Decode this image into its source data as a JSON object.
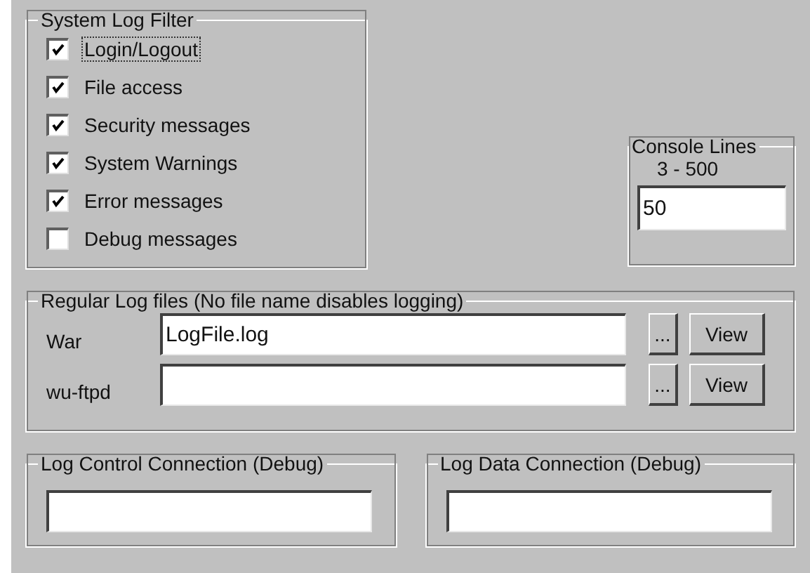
{
  "filter": {
    "title": "System Log Filter",
    "options": [
      {
        "label": "Login/Logout",
        "checked": true,
        "focused": true
      },
      {
        "label": "File access",
        "checked": true,
        "focused": false
      },
      {
        "label": "Security messages",
        "checked": true,
        "focused": false
      },
      {
        "label": "System Warnings",
        "checked": true,
        "focused": false
      },
      {
        "label": "Error messages",
        "checked": true,
        "focused": false
      },
      {
        "label": "Debug messages",
        "checked": false,
        "focused": false
      }
    ]
  },
  "console": {
    "title": "Console Lines",
    "range": "3 - 500",
    "value": "50"
  },
  "log_files": {
    "title": "Regular Log files (No file name disables logging)",
    "rows": [
      {
        "label": "War",
        "value": "LogFile.log",
        "browse": "...",
        "view": "View"
      },
      {
        "label": "wu-ftpd",
        "browse": "...",
        "view": "View"
      }
    ]
  },
  "connections": [
    {
      "title": "Log Control Connection (Debug)"
    },
    {
      "title": "Log Data Connection (Debug)"
    }
  ]
}
